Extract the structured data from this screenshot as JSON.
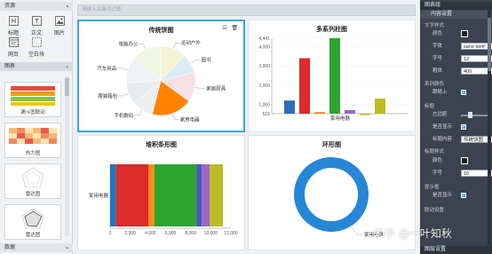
{
  "left": {
    "section_material": "资源",
    "tools": [
      {
        "label": "标题",
        "icon": "title-icon"
      },
      {
        "label": "正文",
        "icon": "text-icon"
      },
      {
        "label": "图片",
        "icon": "image-icon"
      },
      {
        "label": "网页",
        "icon": "webpage-icon"
      },
      {
        "label": "空白块",
        "icon": "blank-block-icon"
      }
    ],
    "section_charts": "图表",
    "thumbnails": [
      {
        "caption": "漏斗图联动"
      },
      {
        "caption": "热力图"
      },
      {
        "caption": "雷达图"
      },
      {
        "caption": "雷达图"
      }
    ],
    "section_data": "数据"
  },
  "center": {
    "search_placeholder": "请输入关键词过滤",
    "pie": {
      "title": "传统饼图",
      "labels": [
        "运动户外",
        "图书",
        "家居厨具",
        "家用电器",
        "手机数码",
        "服装箱包",
        "汽车用品",
        "电脑办公"
      ]
    },
    "bar": {
      "title": "多系列柱图",
      "category": "家用电器",
      "ticks": [
        "4,441",
        "4,000",
        "3,000",
        "2,000",
        "1,000",
        "515"
      ]
    },
    "hbar": {
      "title": "堆积条形图",
      "category": "家用电器",
      "ticks": [
        "0",
        "2,000",
        "4,000",
        "6,000",
        "8,000",
        "10,000",
        "12,000"
      ]
    },
    "ring": {
      "title": "环形图",
      "label": "家用电器"
    }
  },
  "right": {
    "tab": "图表组",
    "section_content": "内容设置",
    "sub_text": "文字样式",
    "color_label": "颜色",
    "font_label": "字体",
    "font_value": "sans-serif",
    "size_label": "字号",
    "size_value": "12",
    "weight_label": "粗体",
    "weight_value": "400",
    "series_color": "系列颜色",
    "follow_label": "跟随上",
    "title_section": "标题",
    "left_label": "左边距",
    "show_label": "是否显示",
    "title_content_label": "标题内容",
    "title_content_value": "传统饼图",
    "title_style": "标题样式",
    "title_color_label": "颜色",
    "title_size_label": "字号",
    "title_size_value": "16",
    "tooltip_section": "提示框",
    "tooltip_show_label": "是否显示",
    "link_section": "联动设置",
    "bottom_head": "图层设置"
  },
  "watermark": "知乎 @一叶知秋",
  "chart_data": [
    {
      "type": "pie",
      "title": "传统饼图",
      "categories": [
        "运动户外",
        "图书",
        "家居厨具",
        "家用电器",
        "手机数码",
        "服装箱包",
        "汽车用品",
        "电脑办公"
      ],
      "values": [
        12,
        9,
        14,
        19,
        10,
        10,
        12,
        14
      ],
      "colors": [
        "#f3f4d2",
        "#dcecf6",
        "#f6e1e4",
        "#ff8200",
        "#eceef2",
        "#e7ebef",
        "#eff2f5",
        "#f1f5e4"
      ]
    },
    {
      "type": "bar",
      "title": "多系列柱图",
      "categories": [
        "家用电器"
      ],
      "series": [
        {
          "values": [
            1200
          ],
          "color": "#2f6db5"
        },
        {
          "values": [
            3400
          ],
          "color": "#dd2a2a"
        },
        {
          "values": [
            600
          ],
          "color": "#ff8a18"
        },
        {
          "values": [
            4441
          ],
          "color": "#2ea42e"
        },
        {
          "values": [
            700
          ],
          "color": "#9c66c2"
        },
        {
          "values": [
            515
          ],
          "color": "#bcbc22"
        },
        {
          "values": [
            1300
          ],
          "color": "#bcbc22"
        }
      ],
      "ylim": [
        515,
        4441
      ]
    },
    {
      "type": "bar",
      "title": "堆积条形图",
      "categories": [
        "家用电器"
      ],
      "series": [
        {
          "values": [
            600
          ],
          "color": "#1f77b4"
        },
        {
          "values": [
            3200
          ],
          "color": "#dd2a2a"
        },
        {
          "values": [
            600
          ],
          "color": "#ff8a18"
        },
        {
          "values": [
            4200
          ],
          "color": "#2ea42e"
        },
        {
          "values": [
            500
          ],
          "color": "#4a52c0"
        },
        {
          "values": [
            800
          ],
          "color": "#9c66c2"
        },
        {
          "values": [
            900
          ],
          "color": "#bcbc22"
        },
        {
          "values": [
            400
          ],
          "color": "#bcbc22"
        }
      ],
      "xlim": [
        0,
        12000
      ]
    },
    {
      "type": "pie",
      "title": "环形图",
      "categories": [
        "家用电器"
      ],
      "values": [
        100
      ],
      "colors": [
        "#2687d6"
      ]
    }
  ]
}
